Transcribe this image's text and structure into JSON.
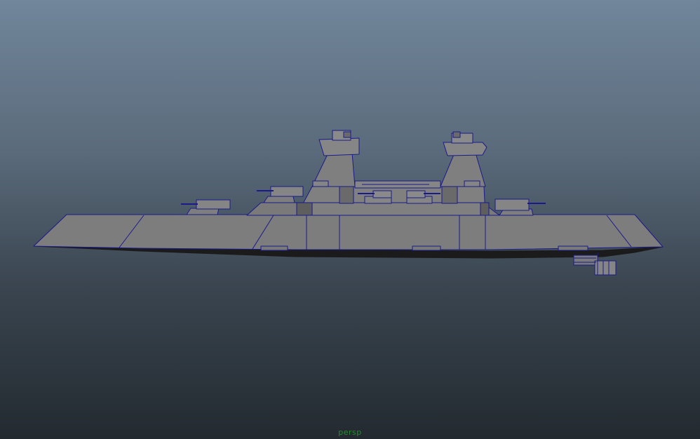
{
  "viewport": {
    "camera_label": "persp"
  },
  "colors": {
    "hull_fill": "#7d7d7d",
    "hull_dark": "#5e5e5e",
    "wire": "#1a1a8c",
    "keel": "#1b1b1b",
    "camera_label": "#1f8f2a"
  },
  "scene": {
    "object": "battleship-model",
    "display_mode": "wireframe-on-shaded"
  }
}
